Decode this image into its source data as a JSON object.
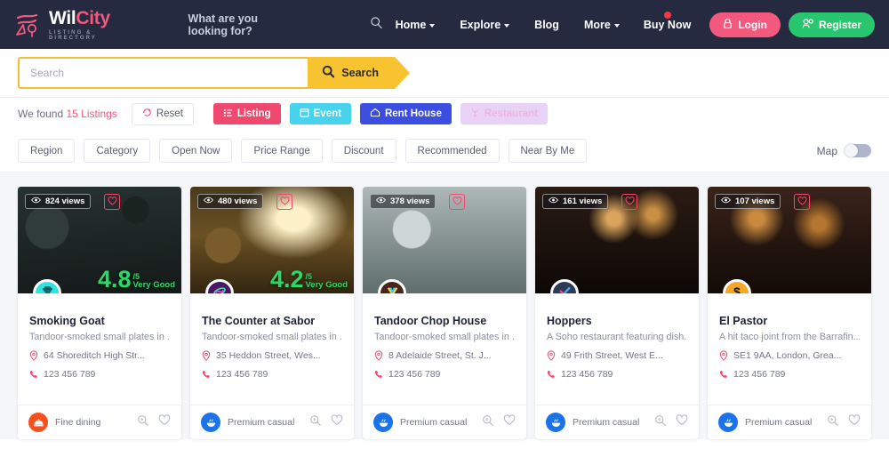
{
  "brand": {
    "name_part1": "Wil",
    "name_part2": "City",
    "tagline": "LISTING & DIRECTORY"
  },
  "header": {
    "search_prompt": "What are you looking for?",
    "search_icon": "search-icon",
    "nav": [
      {
        "label": "Home",
        "caret": true
      },
      {
        "label": "Explore",
        "caret": true
      },
      {
        "label": "Blog",
        "caret": false
      },
      {
        "label": "More",
        "caret": true
      }
    ],
    "buy_now": "Buy Now",
    "login": "Login",
    "register": "Register",
    "login_icon": "lock-icon",
    "register_icon": "user-add-icon",
    "colors": {
      "bar": "#252a41",
      "brand_pink": "#f2597d",
      "login": "#f2597d",
      "register": "#28c76f",
      "dot": "#fb3640"
    }
  },
  "search": {
    "placeholder": "Search",
    "value": "",
    "button_label": "Search",
    "button_icon": "search-icon",
    "accent": "#f7c330"
  },
  "results": {
    "found_prefix": "We found ",
    "found_count": "15 Listings",
    "reset_label": "Reset",
    "reset_icon": "reset-arrow-icon",
    "categories": [
      {
        "label": "Listing",
        "icon": "list-icon",
        "color": "#f1486f"
      },
      {
        "label": "Event",
        "icon": "calendar-icon",
        "color": "#47d2ee"
      },
      {
        "label": "Rent House",
        "icon": "home-icon",
        "color": "#3b4ee0"
      },
      {
        "label": "Restaurant",
        "icon": "restaurant-icon",
        "color": "#e8d3f7"
      }
    ]
  },
  "filters": {
    "buttons": [
      "Region",
      "Category",
      "Open Now",
      "Price Range",
      "Discount",
      "Recommended",
      "Near By Me"
    ],
    "map_label": "Map",
    "map_enabled": false
  },
  "listings": [
    {
      "title": "Smoking Goat",
      "description": "Tandoor-smoked small plates in ...",
      "address": "64 Shoreditch High Str...",
      "phone": "123 456 789",
      "views": "824 views",
      "rating": "4.8",
      "rating_out": "/5",
      "rating_word": "Very Good",
      "category": "Fine dining",
      "avatar_icon": "diamond-icon",
      "avatar_color": "#2fe3e3",
      "foot_icon": "dish-cover-icon",
      "foot_color": "#f4511e",
      "photo": "photo1",
      "actions": {
        "zoom_icon": "zoom-in-icon",
        "fav_icon": "heart-icon"
      }
    },
    {
      "title": "The Counter at Sabor",
      "description": "Tandoor-smoked small plates in ...",
      "address": "35 Heddon Street, Wes...",
      "phone": "123 456 789",
      "views": "480 views",
      "rating": "4.2",
      "rating_out": "/5",
      "rating_word": "Very Good",
      "category": "Premium casual",
      "avatar_icon": "swirl-icon",
      "avatar_color": "#4a1566",
      "foot_icon": "hot-bowl-icon",
      "foot_color": "#1a73e8",
      "photo": "photo2",
      "actions": {
        "zoom_icon": "zoom-in-icon",
        "fav_icon": "heart-icon"
      }
    },
    {
      "title": "Tandoor Chop House",
      "description": "Tandoor-smoked small plates in ...",
      "address": "8 Adelaide Street, St. J...",
      "phone": "123 456 789",
      "views": "378 views",
      "rating": "",
      "rating_out": "",
      "rating_word": "",
      "category": "Premium casual",
      "avatar_icon": "chevron-badge-icon",
      "avatar_color": "#4a2418",
      "foot_icon": "hot-bowl-icon",
      "foot_color": "#1a73e8",
      "photo": "photo3",
      "actions": {
        "zoom_icon": "zoom-in-icon",
        "fav_icon": "heart-icon"
      }
    },
    {
      "title": "Hoppers",
      "description": "A Soho restaurant featuring dish...",
      "address": "49 Frith Street, West E...",
      "phone": "123 456 789",
      "views": "161 views",
      "rating": "",
      "rating_out": "",
      "rating_word": "",
      "category": "Premium casual",
      "avatar_icon": "check-icon",
      "avatar_color": "#2b3a56",
      "foot_icon": "hot-bowl-icon",
      "foot_color": "#1a73e8",
      "photo": "photo4",
      "actions": {
        "zoom_icon": "zoom-in-icon",
        "fav_icon": "heart-icon"
      }
    },
    {
      "title": "El Pastor",
      "description": "A hit taco joint from the Barrafin...",
      "address": "SE1 9AA, London, Grea...",
      "phone": "123 456 789",
      "views": "107 views",
      "rating": "",
      "rating_out": "",
      "rating_word": "",
      "category": "Premium casual",
      "avatar_icon": "dollar-icon",
      "avatar_color": "#f5a623",
      "foot_icon": "hot-bowl-icon",
      "foot_color": "#1a73e8",
      "photo": "photo5",
      "actions": {
        "zoom_icon": "zoom-in-icon",
        "fav_icon": "heart-icon"
      }
    }
  ]
}
